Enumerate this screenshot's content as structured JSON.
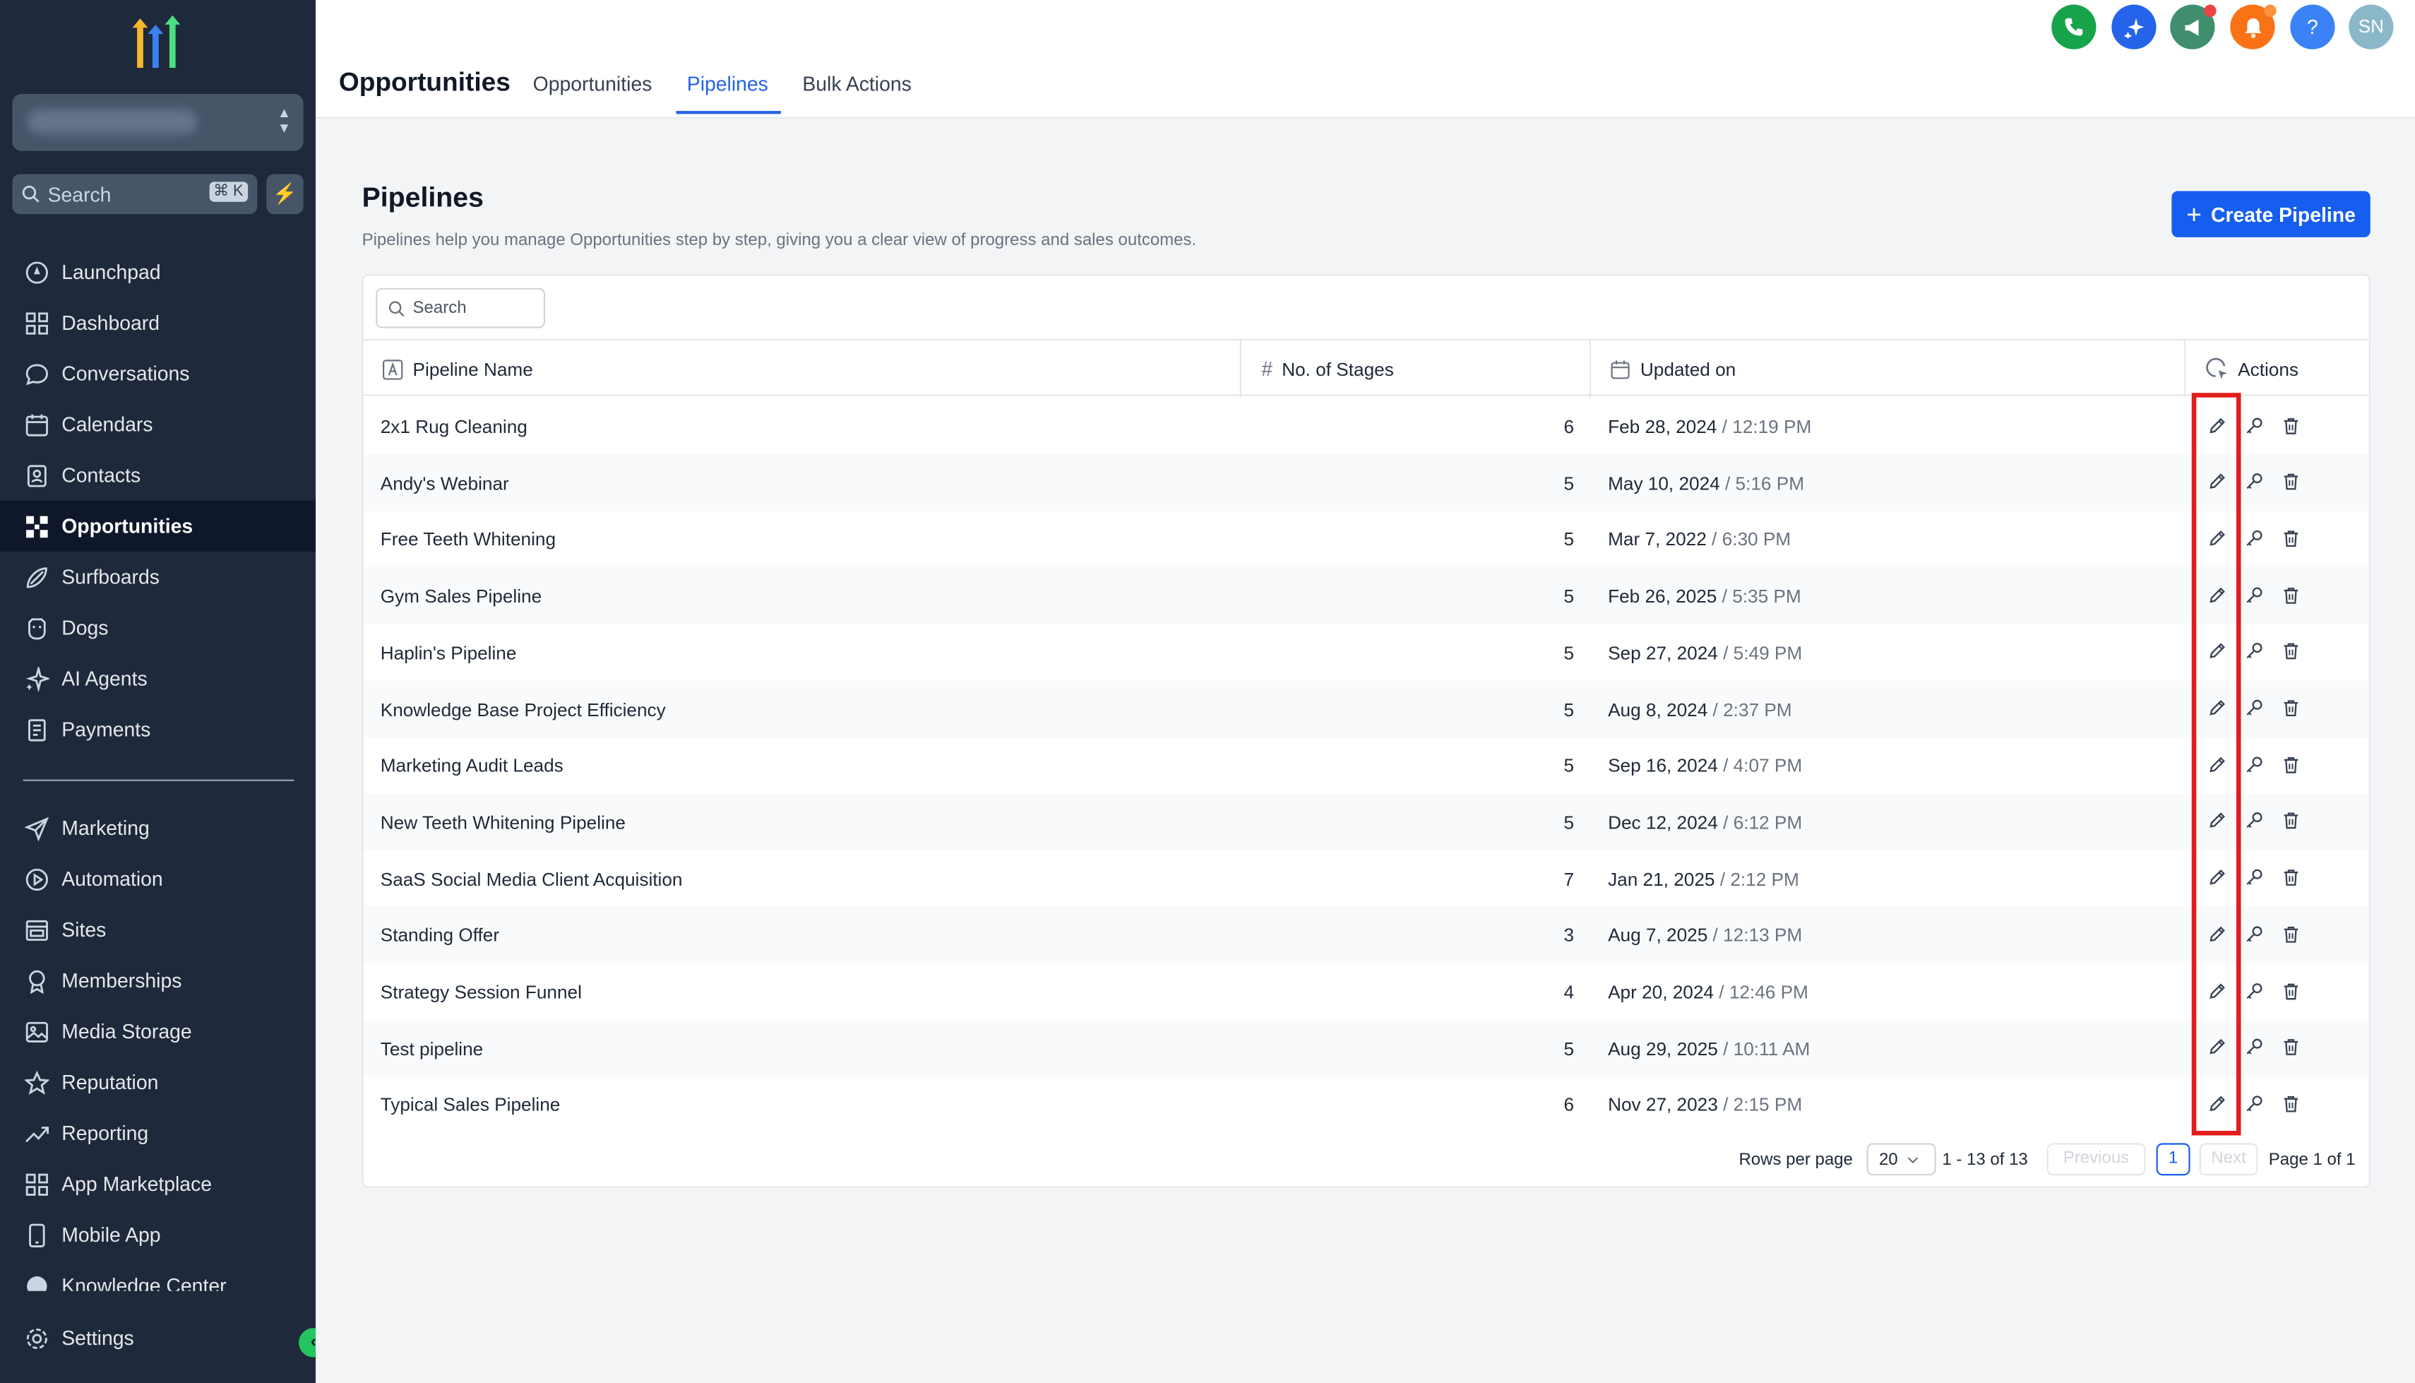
{
  "sidebar": {
    "search_placeholder": "Search",
    "search_shortcut": "⌘ K",
    "nav_primary": [
      {
        "label": "Launchpad",
        "icon": "launchpad-icon"
      },
      {
        "label": "Dashboard",
        "icon": "dashboard-icon"
      },
      {
        "label": "Conversations",
        "icon": "chat-icon"
      },
      {
        "label": "Calendars",
        "icon": "calendar-icon"
      },
      {
        "label": "Contacts",
        "icon": "contacts-icon"
      },
      {
        "label": "Opportunities",
        "icon": "opportunities-icon",
        "active": true
      },
      {
        "label": "Surfboards",
        "icon": "surfboard-icon"
      },
      {
        "label": "Dogs",
        "icon": "dog-icon"
      },
      {
        "label": "AI Agents",
        "icon": "sparkle-icon"
      },
      {
        "label": "Payments",
        "icon": "payments-icon"
      }
    ],
    "nav_secondary": [
      {
        "label": "Marketing",
        "icon": "send-icon"
      },
      {
        "label": "Automation",
        "icon": "automation-icon"
      },
      {
        "label": "Sites",
        "icon": "sites-icon"
      },
      {
        "label": "Memberships",
        "icon": "membership-icon"
      },
      {
        "label": "Media Storage",
        "icon": "media-icon"
      },
      {
        "label": "Reputation",
        "icon": "star-icon"
      },
      {
        "label": "Reporting",
        "icon": "reporting-icon"
      },
      {
        "label": "App Marketplace",
        "icon": "marketplace-icon"
      },
      {
        "label": "Mobile App",
        "icon": "mobile-icon"
      },
      {
        "label": "Knowledge Center",
        "icon": "knowledge-icon"
      }
    ],
    "settings_label": "Settings"
  },
  "header": {
    "title": "Opportunities",
    "tabs": [
      {
        "label": "Opportunities"
      },
      {
        "label": "Pipelines",
        "active": true
      },
      {
        "label": "Bulk Actions"
      }
    ],
    "avatar_initials": "SN",
    "icon_colors": {
      "phone": "#16a34a",
      "sparkle": "#2563eb",
      "megaphone": "#3f8f6e",
      "bell": "#f97316",
      "help": "#3b82f6",
      "avatar": "#8bb8c8"
    }
  },
  "page": {
    "title": "Pipelines",
    "subtitle": "Pipelines help you manage Opportunities step by step, giving you a clear view of progress and sales outcomes.",
    "create_label": "Create Pipeline"
  },
  "table": {
    "search_placeholder": "Search",
    "columns": {
      "name": "Pipeline Name",
      "stages": "No. of Stages",
      "updated": "Updated on",
      "actions": "Actions"
    },
    "rows": [
      {
        "name": "2x1 Rug Cleaning",
        "stages": "6",
        "date": "Feb 28, 2024",
        "time": "12:19 PM"
      },
      {
        "name": "Andy's Webinar",
        "stages": "5",
        "date": "May 10, 2024",
        "time": "5:16 PM"
      },
      {
        "name": "Free Teeth Whitening",
        "stages": "5",
        "date": "Mar 7, 2022",
        "time": "6:30 PM"
      },
      {
        "name": "Gym Sales Pipeline",
        "stages": "5",
        "date": "Feb 26, 2025",
        "time": "5:35 PM"
      },
      {
        "name": "Haplin's Pipeline",
        "stages": "5",
        "date": "Sep 27, 2024",
        "time": "5:49 PM"
      },
      {
        "name": "Knowledge Base Project Efficiency",
        "stages": "5",
        "date": "Aug 8, 2024",
        "time": "2:37 PM"
      },
      {
        "name": "Marketing Audit Leads",
        "stages": "5",
        "date": "Sep 16, 2024",
        "time": "4:07 PM"
      },
      {
        "name": "New Teeth Whitening Pipeline",
        "stages": "5",
        "date": "Dec 12, 2024",
        "time": "6:12 PM"
      },
      {
        "name": "SaaS Social Media Client Acquisition",
        "stages": "7",
        "date": "Jan 21, 2025",
        "time": "2:12 PM"
      },
      {
        "name": "Standing Offer",
        "stages": "3",
        "date": "Aug 7, 2025",
        "time": "12:13 PM"
      },
      {
        "name": "Strategy Session Funnel",
        "stages": "4",
        "date": "Apr 20, 2024",
        "time": "12:46 PM"
      },
      {
        "name": "Test pipeline",
        "stages": "5",
        "date": "Aug 29, 2025",
        "time": "10:11 AM"
      },
      {
        "name": "Typical Sales Pipeline",
        "stages": "6",
        "date": "Nov 27, 2023",
        "time": "2:15 PM"
      }
    ],
    "date_separator": " / "
  },
  "pagination": {
    "rows_per_page_label": "Rows per page",
    "rows_per_page_value": "20",
    "range": "1 - 13 of 13",
    "previous": "Previous",
    "current_page": "1",
    "next": "Next",
    "page_of": "Page 1 of 1"
  }
}
